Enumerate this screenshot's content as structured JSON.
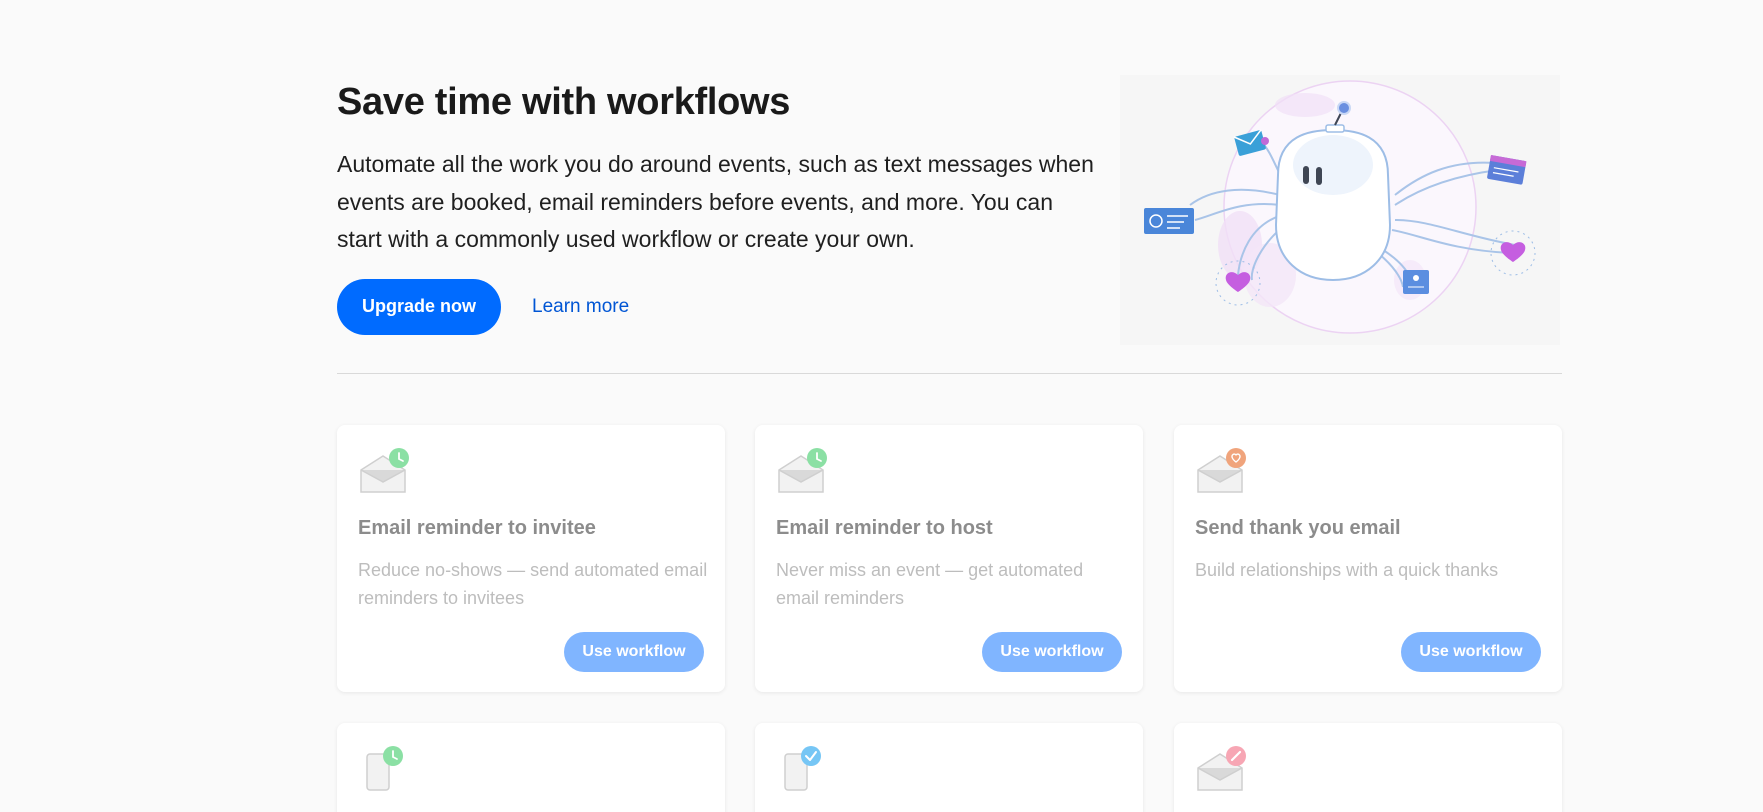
{
  "hero": {
    "title": "Save time with workflows",
    "description": "Automate all the work you do around events, such as text messages when events are booked, email reminders before events, and more. You can start with a commonly used workflow or create your own.",
    "upgrade_label": "Upgrade now",
    "learn_more_label": "Learn more"
  },
  "colors": {
    "primary": "#006bff",
    "primary_faded": "#80b5ff",
    "badge_green": "#8be0a4",
    "badge_orange": "#f0a47c",
    "badge_blue": "#76c6f5",
    "badge_pink": "#f7a6b4"
  },
  "cards": [
    {
      "icon": "envelope-clock-icon",
      "title": "Email reminder to invitee",
      "description": "Reduce no-shows — send automated email reminders to invitees",
      "button_label": "Use workflow"
    },
    {
      "icon": "envelope-clock-icon",
      "title": "Email reminder to host",
      "description": "Never miss an event — get automated email reminders",
      "button_label": "Use workflow"
    },
    {
      "icon": "envelope-heart-icon",
      "title": "Send thank you email",
      "description": "Build relationships with a quick thanks",
      "button_label": "Use workflow"
    },
    {
      "icon": "phone-clock-icon"
    },
    {
      "icon": "phone-check-icon"
    },
    {
      "icon": "envelope-pencil-icon"
    }
  ]
}
